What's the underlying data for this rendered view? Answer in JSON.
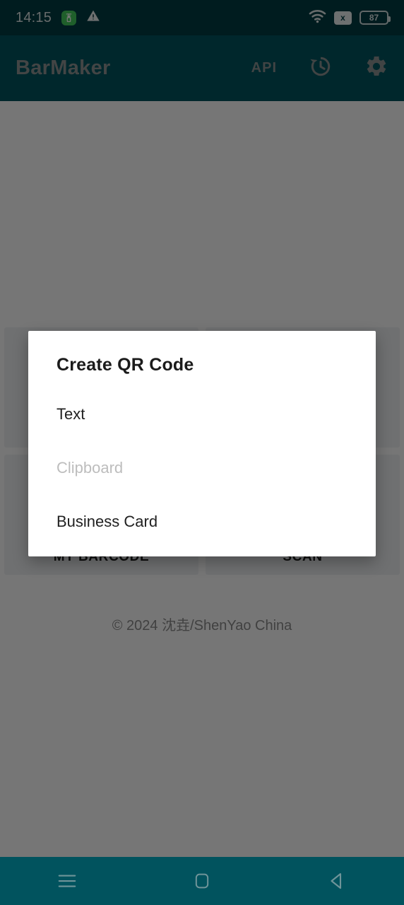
{
  "status_bar": {
    "clock": "14:15",
    "icons": [
      {
        "name": "notification-badge-icon",
        "label": ""
      },
      {
        "name": "warning-triangle-icon",
        "label": ""
      },
      {
        "name": "wifi-icon",
        "label": ""
      },
      {
        "name": "no-sim-icon",
        "label": "x"
      },
      {
        "name": "battery-icon",
        "label": "87"
      }
    ],
    "battery_level": "87",
    "no_sim_glyph": "x",
    "background_color": "#023c43"
  },
  "app_bar": {
    "title": "BarMaker",
    "api_label": "API",
    "history_icon": "history-icon",
    "settings_icon": "gear-icon",
    "background_color": "#01535e",
    "title_color": "#8f9494"
  },
  "main": {
    "tiles": [
      [
        {
          "label": "",
          "name": "tile-create-barcode"
        },
        {
          "label": "",
          "name": "tile-create-qr"
        }
      ],
      [
        {
          "label": "MY BARCODE",
          "name": "tile-my-barcode"
        },
        {
          "label": "SCAN",
          "name": "tile-scan"
        }
      ]
    ],
    "copyright": "© 2024 沈垚/ShenYao China"
  },
  "dialog": {
    "title": "Create QR Code",
    "items": [
      {
        "label": "Text",
        "disabled": false
      },
      {
        "label": "Clipboard",
        "disabled": true
      },
      {
        "label": "Business Card",
        "disabled": false
      }
    ],
    "background_color": "#ffffff"
  },
  "nav_bar": {
    "buttons": [
      {
        "name": "recents-button",
        "icon": "hamburger-icon"
      },
      {
        "name": "home-button",
        "icon": "square-icon"
      },
      {
        "name": "back-button",
        "icon": "triangle-left-icon"
      }
    ],
    "background_color": "#01535e"
  }
}
